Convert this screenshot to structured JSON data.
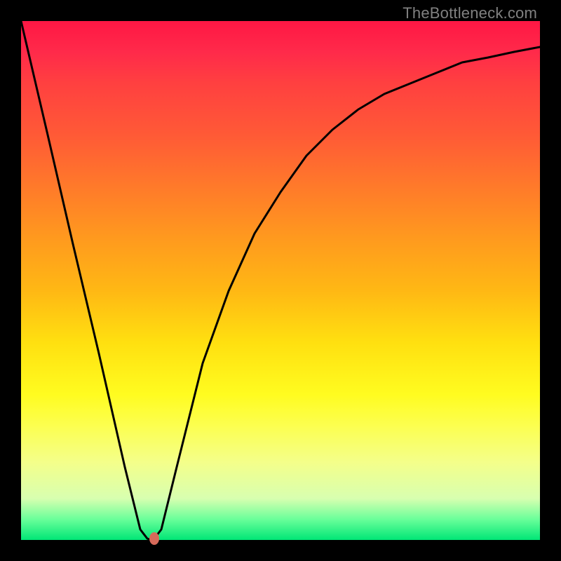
{
  "attribution": "TheBottleneck.com",
  "chart_data": {
    "type": "line",
    "title": "",
    "xlabel": "",
    "ylabel": "",
    "x": [
      0.0,
      0.05,
      0.1,
      0.15,
      0.2,
      0.23,
      0.25,
      0.27,
      0.3,
      0.35,
      0.4,
      0.45,
      0.5,
      0.55,
      0.6,
      0.65,
      0.7,
      0.75,
      0.8,
      0.85,
      0.9,
      0.95,
      1.0
    ],
    "values": [
      100,
      79,
      57,
      36,
      14,
      2,
      0,
      2,
      14,
      34,
      48,
      59,
      67,
      74,
      79,
      83,
      86,
      88,
      90,
      92,
      93,
      94,
      95
    ],
    "xlim": [
      0,
      1
    ],
    "ylim": [
      0,
      100
    ],
    "minimum_point": {
      "x": 0.25,
      "y": 0
    },
    "gradient_colors_top_to_bottom": [
      "#ff1744",
      "#ff7a2a",
      "#ffe010",
      "#fcff50",
      "#00e676"
    ],
    "background_outside_plot": "#000000",
    "curve_color": "#000000",
    "dot_color": "#d66a5a"
  }
}
